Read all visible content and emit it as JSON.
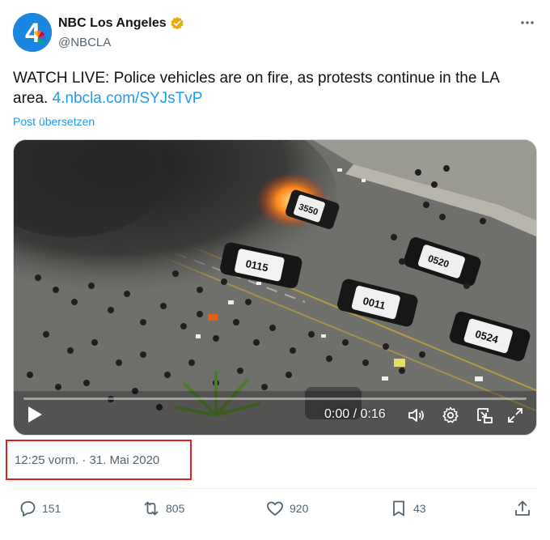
{
  "account": {
    "display_name": "NBC Los Angeles",
    "handle": "@NBCLA",
    "avatar_text": "4",
    "verified_color": "#e8a912"
  },
  "tweet": {
    "text": "WATCH LIVE: Police vehicles are on fire, as protests continue in the LA area.",
    "link": "4.nbcla.com/SYJsTvP",
    "translate_label": "Post übersetzen"
  },
  "video": {
    "time": "0:00 / 0:16",
    "car_numbers": [
      "3550",
      "0115",
      "0011",
      "0520",
      "0524"
    ]
  },
  "timestamp": "12:25 vorm. · 31. Mai 2020",
  "actions": {
    "replies": "151",
    "reposts": "805",
    "likes": "920",
    "bookmarks": "43"
  },
  "colors": {
    "accent": "#1d9bf0",
    "secondary_text": "#536471",
    "highlight_border": "#e02020"
  }
}
